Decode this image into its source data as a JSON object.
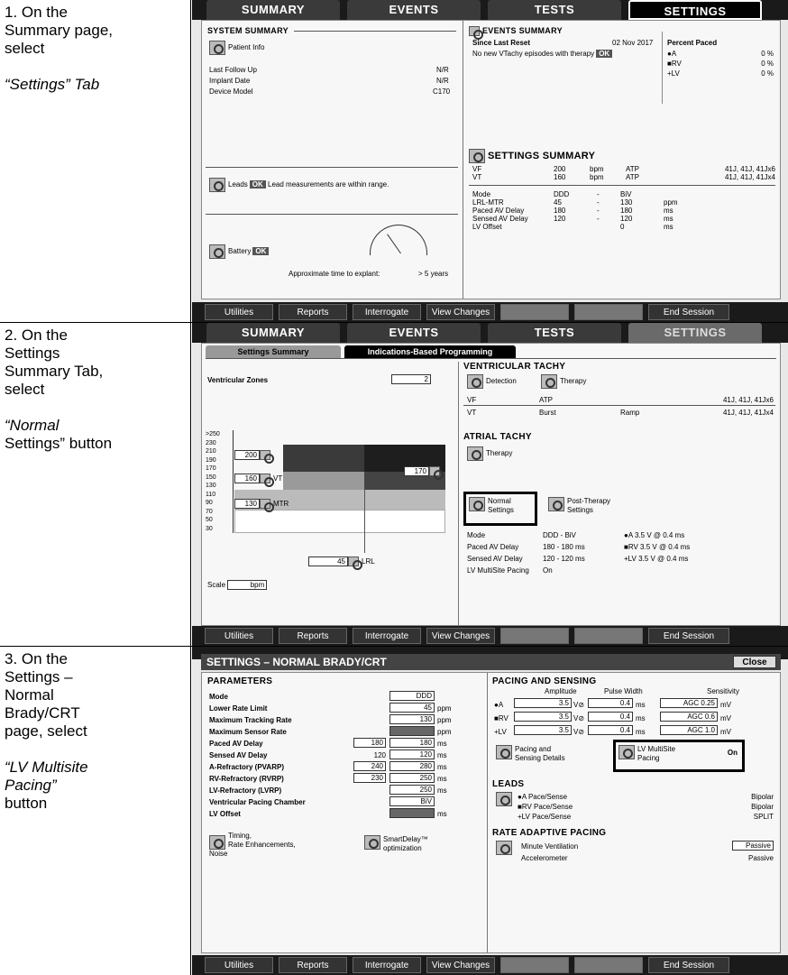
{
  "steps": [
    {
      "lines": [
        "1. On the",
        "Summary page,",
        "select"
      ],
      "quote": "“Settings” Tab"
    },
    {
      "lines": [
        "2. On the",
        "Settings",
        "Summary Tab,",
        "select"
      ],
      "quote": "“Normal",
      "quote2": "Settings” button"
    },
    {
      "lines": [
        "3. On the",
        "Settings –",
        "Normal",
        "Brady/CRT",
        "page, select"
      ],
      "quote": "“LV Multisite",
      "quote2": "Pacing”",
      "quote3": "button"
    }
  ],
  "tabs": [
    "SUMMARY",
    "EVENTS",
    "TESTS",
    "SETTINGS"
  ],
  "bottom_buttons": [
    "Utilities",
    "Reports",
    "Interrogate",
    "View Changes",
    "",
    "",
    "End Session"
  ],
  "s1": {
    "system_summary": "SYSTEM SUMMARY",
    "patient_info": "Patient Info",
    "last_follow_up": "Last Follow Up",
    "last_follow_up_val": "N/R",
    "implant_date": "Implant Date",
    "implant_date_val": "N/R",
    "device_model": "Device Model",
    "device_model_val": "C170",
    "leads": "Leads",
    "ok": "OK",
    "leads_msg": "Lead measurements are within range.",
    "battery": "Battery",
    "explant": "Approximate time to explant:",
    "explant_val": "> 5 years",
    "events_summary": "EVENTS SUMMARY",
    "since_reset": "Since Last Reset",
    "reset_date": "02 Nov 2017",
    "no_vtachy": "No new VTachy episodes with therapy",
    "percent_paced": "Percent Paced",
    "paced": [
      {
        "l": "●A",
        "v": "0",
        "u": "%"
      },
      {
        "l": "■RV",
        "v": "0",
        "u": "%"
      },
      {
        "l": "+LV",
        "v": "0",
        "u": "%"
      }
    ],
    "settings_summary": "SETTINGS SUMMARY",
    "zones": [
      {
        "z": "VF",
        "rate": "200",
        "u": "bpm",
        "th": "ATP",
        "v": "41J, 41J, 41Jx6"
      },
      {
        "z": "VT",
        "rate": "160",
        "u": "bpm",
        "th": "ATP",
        "v": "41J, 41J, 41Jx4"
      }
    ],
    "params": [
      {
        "n": "Mode",
        "a": "DDD",
        "d": "-",
        "b": "BiV",
        "u": ""
      },
      {
        "n": "LRL-MTR",
        "a": "45",
        "d": "-",
        "b": "130",
        "u": "ppm"
      },
      {
        "n": "Paced AV Delay",
        "a": "180",
        "d": "-",
        "b": "180",
        "u": "ms"
      },
      {
        "n": "Sensed AV Delay",
        "a": "120",
        "d": "-",
        "b": "120",
        "u": "ms"
      },
      {
        "n": "LV Offset",
        "a": "",
        "d": "",
        "b": "0",
        "u": "ms"
      }
    ]
  },
  "s2": {
    "subtab1": "Settings Summary",
    "subtab2": "Indications-Based Programming",
    "vzones": "Ventricular Zones",
    "vzones_val": "2",
    "yticks": [
      ">250",
      "230",
      "210",
      "190",
      "170",
      "150",
      "130",
      "110",
      "90",
      "70",
      "50",
      "30"
    ],
    "vf_val": "200",
    "vt_val": "160",
    "vt_label": "VT",
    "mtr_val": "130",
    "mtr": "MTR",
    "v170": "170",
    "lrl_val": "45",
    "lrl": "LRL",
    "scale": "Scale",
    "scale_unit": "bpm",
    "vtachy": "VENTRICULAR TACHY",
    "detection": "Detection",
    "therapy": "Therapy",
    "vf": "VF",
    "vf_th": "ATP",
    "vf_v": "41J, 41J, 41Jx6",
    "vt": "VT",
    "vt_th": "Burst",
    "vt_th2": "Ramp",
    "vt_v": "41J, 41J, 41Jx4",
    "atachy": "ATRIAL TACHY",
    "a_therapy": "Therapy",
    "normal": "Normal",
    "normal2": "Settings",
    "post": "Post-Therapy",
    "post2": "Settings",
    "mode": "Mode",
    "mode_v": "DDD  -  BiV",
    "paced_av": "Paced AV Delay",
    "paced_av_v": "180  -  180  ms",
    "sensed_av": "Sensed AV Delay",
    "sensed_av_v": "120  -  120  ms",
    "lv_ms": "LV MultiSite Pacing",
    "lv_ms_v": "On",
    "amp": [
      {
        "l": "●A",
        "v": "3.5 V @ 0.4 ms"
      },
      {
        "l": "■RV",
        "v": "3.5 V @ 0.4 ms"
      },
      {
        "l": "+LV",
        "v": "3.5 V @ 0.4 ms"
      }
    ]
  },
  "s3": {
    "title": "SETTINGS – NORMAL BRADY/CRT",
    "close": "Close",
    "parameters": "PARAMETERS",
    "rows": [
      {
        "n": "Mode",
        "a": "",
        "v": "DDD",
        "u": ""
      },
      {
        "n": "Lower Rate Limit",
        "a": "",
        "v": "45",
        "u": "ppm"
      },
      {
        "n": "Maximum Tracking Rate",
        "a": "",
        "v": "130",
        "u": "ppm"
      },
      {
        "n": "Maximum Sensor Rate",
        "a": "",
        "v": "",
        "u": "ppm"
      },
      {
        "n": "Paced AV Delay",
        "a": "180",
        "v": "180",
        "u": "ms"
      },
      {
        "n": "Sensed AV Delay",
        "a": "120",
        "v": "120",
        "u": "ms"
      },
      {
        "n": "A-Refractory (PVARP)",
        "a": "240",
        "v": "280",
        "u": "ms"
      },
      {
        "n": "RV-Refractory (RVRP)",
        "a": "230",
        "v": "250",
        "u": "ms"
      },
      {
        "n": "LV-Refractory (LVRP)",
        "a": "",
        "v": "250",
        "u": "ms"
      },
      {
        "n": "Ventricular Pacing Chamber",
        "a": "",
        "v": "BiV",
        "u": ""
      },
      {
        "n": "LV Offset",
        "a": "",
        "v": "",
        "u": "ms"
      }
    ],
    "timing": "Timing,",
    "timing2": "Rate Enhancements,",
    "timing3": "Noise",
    "smartdelay": "SmartDelay™",
    "smartdelay2": "optimization",
    "pacing": "PACING AND SENSING",
    "h_amp": "Amplitude",
    "h_pw": "Pulse Width",
    "h_sens": "Sensitivity",
    "ps": [
      {
        "l": "●A",
        "a": "3.5",
        "pw": "0.4",
        "s": "AGC 0.25",
        "u": "mV"
      },
      {
        "l": "■RV",
        "a": "3.5",
        "pw": "0.4",
        "s": "AGC 0.6",
        "u": "mV"
      },
      {
        "l": "+LV",
        "a": "3.5",
        "pw": "0.4",
        "s": "AGC 1.0",
        "u": "mV"
      }
    ],
    "psd": "Pacing and",
    "psd2": "Sensing Details",
    "lvmp": "LV MultiSite",
    "lvmp2": "Pacing",
    "lvmp_v": "On",
    "leads": "LEADS",
    "lead_rows": [
      {
        "l": "●A  Pace/Sense",
        "v": "Bipolar"
      },
      {
        "l": "■RV  Pace/Sense",
        "v": "Bipolar"
      },
      {
        "l": "+LV  Pace/Sense",
        "v": "SPLIT"
      }
    ],
    "rap": "RATE ADAPTIVE PACING",
    "mv": "Minute Ventilation",
    "mv_v": "Passive",
    "acc": "Accelerometer",
    "acc_v": "Passive"
  }
}
